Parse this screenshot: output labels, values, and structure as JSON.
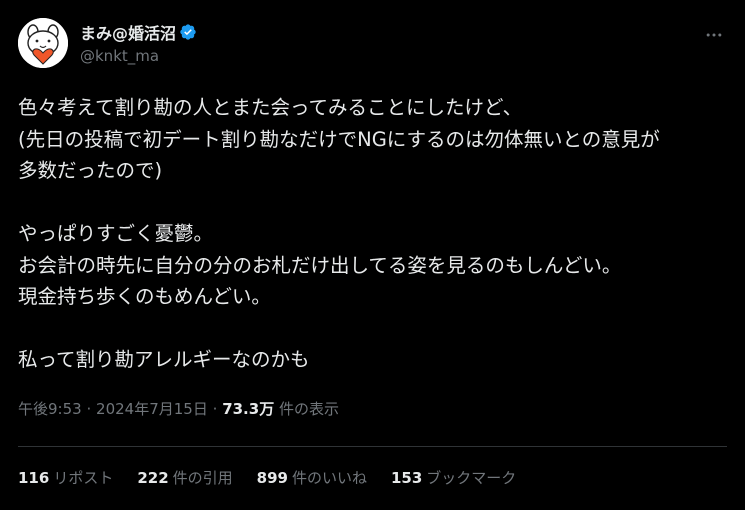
{
  "author": {
    "display_name": "まみ@婚活沼",
    "handle": "@knkt_ma",
    "verified_icon": "verified-badge-icon",
    "accent_color": "#1d9bf0"
  },
  "tweet": {
    "lines": [
      "色々考えて割り勘の人とまた会ってみることにしたけど、",
      "(先日の投稿で初デート割り勘なだけでNGにするのは勿体無いとの意見が",
      "多数だったので)",
      "",
      "やっぱりすごく憂鬱。",
      "お会計の時先に自分の分のお札だけ出してる姿を見るのもしんどい。",
      "現金持ち歩くのもめんどい。",
      "",
      "私って割り勘アレルギーなのかも"
    ]
  },
  "meta": {
    "time": "午後9:53",
    "separator": "·",
    "date": "2024年7月15日",
    "views_count": "73.3万",
    "views_label": "件の表示"
  },
  "stats": {
    "reposts": {
      "count": "116",
      "label": "リポスト"
    },
    "quotes": {
      "count": "222",
      "label": "件の引用"
    },
    "likes": {
      "count": "899",
      "label": "件のいいね"
    },
    "bookmarks": {
      "count": "153",
      "label": "ブックマーク"
    }
  }
}
